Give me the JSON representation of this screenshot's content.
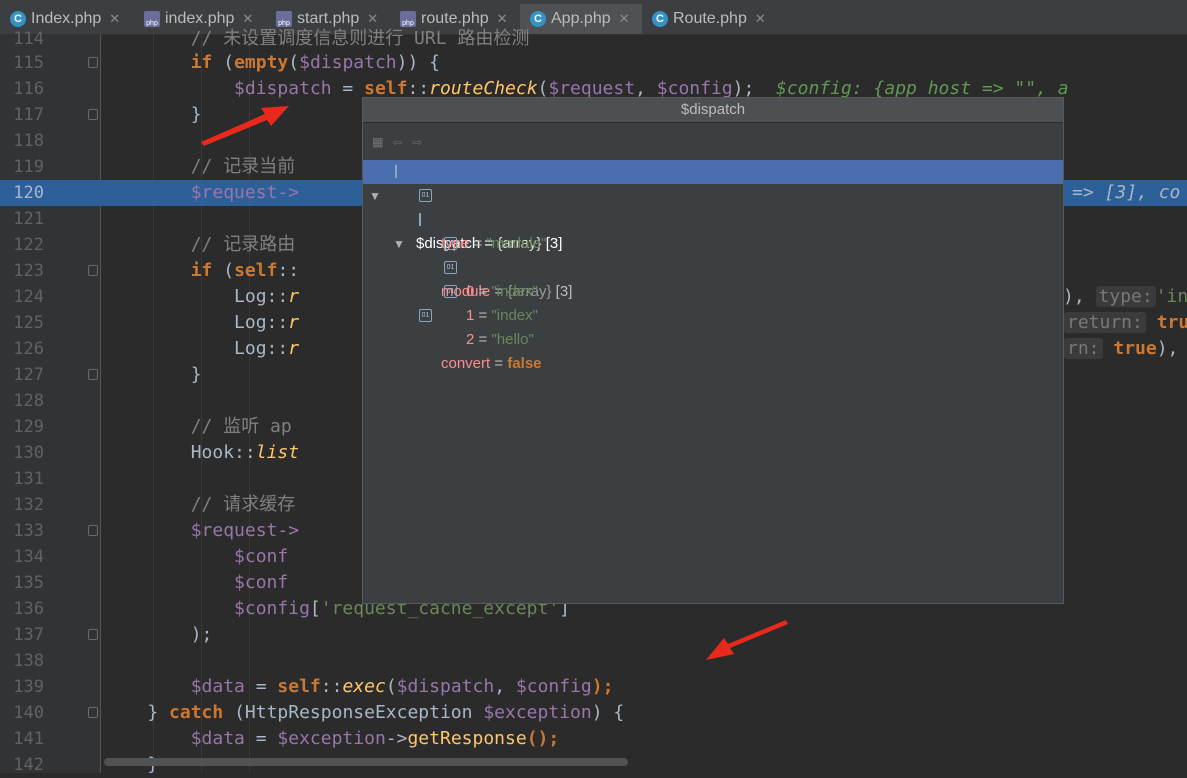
{
  "tabs": [
    {
      "label": "Index.php",
      "icon": "class-icon",
      "active": false
    },
    {
      "label": "index.php",
      "icon": "php-file-icon",
      "active": false
    },
    {
      "label": "start.php",
      "icon": "php-file-icon",
      "active": false
    },
    {
      "label": "route.php",
      "icon": "php-file-icon",
      "active": false
    },
    {
      "label": "App.php",
      "icon": "class-icon",
      "active": true
    },
    {
      "label": "Route.php",
      "icon": "class-icon",
      "active": false
    }
  ],
  "lines": {
    "l114": "114",
    "l115": "115",
    "l116": "116",
    "l117": "117",
    "l118": "118",
    "l119": "119",
    "l120": "120",
    "l121": "121",
    "l122": "122",
    "l123": "123",
    "l124": "124",
    "l125": "125",
    "l126": "126",
    "l127": "127",
    "l128": "128",
    "l129": "129",
    "l130": "130",
    "l131": "131",
    "l132": "132",
    "l133": "133",
    "l134": "134",
    "l135": "135",
    "l136": "136",
    "l137": "137",
    "l138": "138",
    "l139": "139",
    "l140": "140",
    "l141": "141",
    "l142": "142"
  },
  "code": {
    "c114": "// 未设置调度信息则进行 URL 路由检测",
    "c115_kw": "if",
    "c115_a": " (",
    "c115_fn": "empty",
    "c115_b": "(",
    "c115_v": "$dispatch",
    "c115_c": ")) {",
    "c116_v": "$dispatch",
    "c116_a": " = ",
    "c116_kw": "self",
    "c116_b": "::",
    "c116_fn": "routeCheck",
    "c116_c": "(",
    "c116_v2": "$request",
    "c116_d": ", ",
    "c116_v3": "$config",
    "c116_e": ");",
    "c116_hint": "$config: {app_host => \"\", a",
    "c117": "}",
    "c119": "// 记录当前",
    "c120_v": "$request->",
    "c120_tail": "=> [3], co",
    "c122": "// 记录路由",
    "c123_kw": "if",
    "c123_a": " (",
    "c123_kw2": "self",
    "c123_b": "::",
    "c124": "Log::",
    "c124_fn": "r",
    "c124_tail": "),",
    "c124_inl": "type:",
    "c124_str": "'in",
    "c125": "Log::",
    "c125_fn": "r",
    "c125_inl": "return:",
    "c125_true": "true",
    "c126": "Log::",
    "c126_fn": "r",
    "c126_inl": "rn:",
    "c126_true": "true",
    "c126_tail": "),",
    "c127": "}",
    "c129": "// 监听 ap",
    "c130": "Hook::",
    "c130_fn": "list",
    "c132": "// 请求缓存",
    "c133_v": "$request->",
    "c134_v": "$conf",
    "c135_v": "$conf",
    "c136_v": "$config",
    "c136_a": "[",
    "c136_s": "'request_cache_except'",
    "c136_b": "]",
    "c137": ");",
    "c139_v": "$data",
    "c139_a": " = ",
    "c139_kw": "self",
    "c139_b": "::",
    "c139_fn": "exec",
    "c139_c": "(",
    "c139_v2": "$dispatch",
    "c139_d": ", ",
    "c139_v3": "$config",
    "c139_e": ");",
    "c140_a": "} ",
    "c140_kw": "catch",
    "c140_b": " (HttpResponseException ",
    "c140_v": "$exception",
    "c140_c": ") {",
    "c141_v": "$data",
    "c141_a": " = ",
    "c141_v2": "$exception",
    "c141_b": "->",
    "c141_fn": "getResponse",
    "c141_c": "();",
    "c142": "}"
  },
  "popup": {
    "title": "$dispatch",
    "toolbar": [
      "folder-icon",
      "back-arrow-icon",
      "forward-arrow-icon"
    ],
    "nodes": {
      "root_name": "$dispatch",
      "root_eq": " = ",
      "root_type": "{array}",
      "root_count": " [3]",
      "type_name": "type",
      "type_eq": " = ",
      "type_val": "\"module\"",
      "module_name": "module",
      "module_eq": " = ",
      "module_type": "{array}",
      "module_count": " [3]",
      "m0_name": "0",
      "m0_eq": " = ",
      "m0_val": "\"index\"",
      "m1_name": "1",
      "m1_eq": " = ",
      "m1_val": "\"index\"",
      "m2_name": "2",
      "m2_eq": " = ",
      "m2_val": "\"hello\"",
      "conv_name": "convert",
      "conv_eq": " = ",
      "conv_val": "false"
    }
  },
  "colors": {
    "editor_bg": "#2b2b2b",
    "keyword": "#cc7832",
    "variable": "#9876aa",
    "function": "#ffc66d",
    "string": "#6a8759",
    "highlight_line": "#2d6099",
    "popup_selected": "#4b6eaf",
    "annotation_arrow": "#e8291c"
  }
}
